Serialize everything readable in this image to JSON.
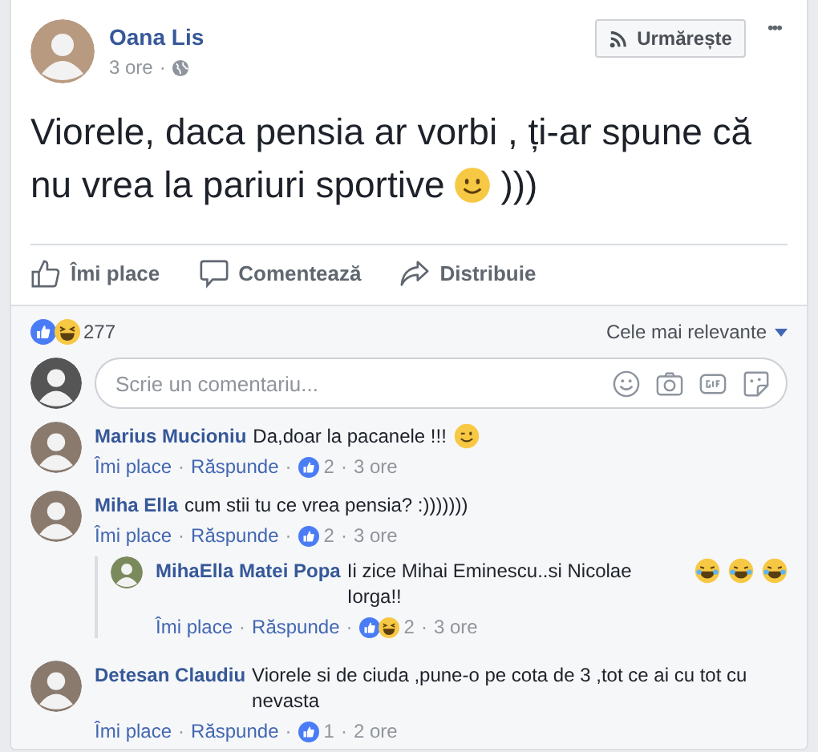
{
  "post": {
    "author": "Oana Lis",
    "time": "3 ore",
    "separator": "·",
    "follow_label": "Urmărește",
    "more": "•••",
    "text_lines": [
      "Viorele, daca pensia ar vorbi , ți-ar spune că",
      "nu vrea la pariuri sportive"
    ],
    "text_end": ")))"
  },
  "actions": [
    {
      "kind": "like",
      "label": "Îmi place"
    },
    {
      "kind": "comment",
      "label": "Comentează"
    },
    {
      "kind": "share",
      "label": "Distribuie"
    }
  ],
  "reactions": {
    "count": "277",
    "sort": "Cele mai relevante"
  },
  "comment_box": {
    "placeholder": "Scrie un comentariu..."
  },
  "comments": [
    {
      "author": "Marius Mucioniu",
      "text": "Da,doar la pacanele !!!",
      "like": "Îmi place",
      "reply": "Răspunde",
      "count": "2",
      "time": "3 ore"
    },
    {
      "author": "Miha Ella",
      "text": "cum stii tu ce vrea pensia? :)))))))",
      "like": "Îmi place",
      "reply": "Răspunde",
      "count": "2",
      "time": "3 ore",
      "children": [
        {
          "author": "MihaElla Matei Popa",
          "text": "Ii zice Mihai Eminescu..si Nicolae Iorga!!",
          "like": "Îmi place",
          "reply": "Răspunde",
          "count": "2",
          "time": "3 ore"
        }
      ]
    },
    {
      "author": "Detesan Claudiu",
      "text": "Viorele si de ciuda ,pune-o pe cota de 3 ,tot ce ai cu tot cu nevasta",
      "like": "Îmi place",
      "reply": "Răspunde",
      "count": "1",
      "time": "2 ore"
    }
  ]
}
